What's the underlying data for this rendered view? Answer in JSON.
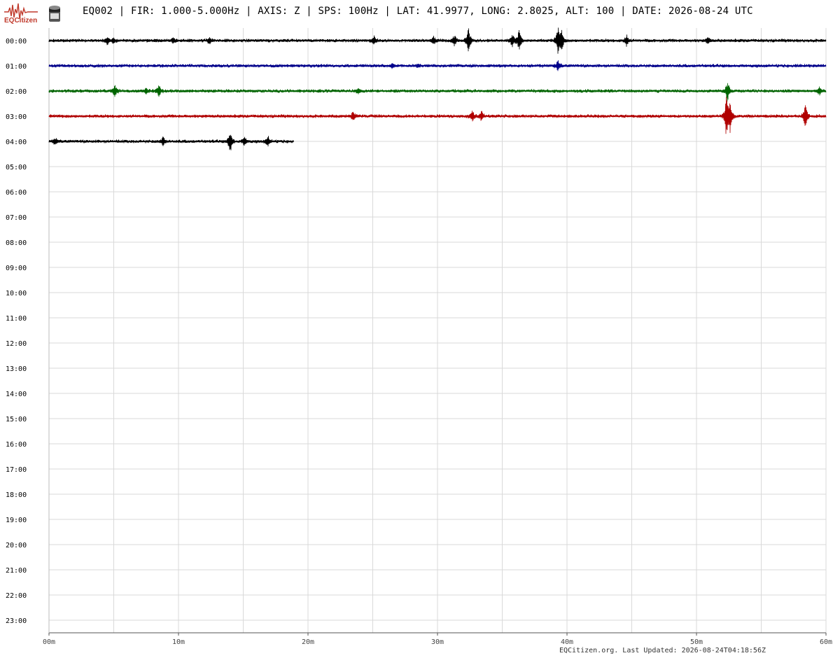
{
  "header": {
    "logo_text": "EQCitizen",
    "title": "EQ002 | FIR: 1.000-5.000Hz | AXIS: Z | SPS: 100Hz | LAT: 41.9977, LONG: 2.8025, ALT: 100 | DATE: 2026-08-24 UTC"
  },
  "footer": {
    "text": "EQCitizen.org. Last Updated: 2026-08-24T04:18:56Z"
  },
  "colors": {
    "grid": "#d9d9d9",
    "axis": "#555555",
    "logo": "#c0392b",
    "trace_cycle": [
      "#000000",
      "#00008b",
      "#006400",
      "#b00000"
    ]
  },
  "chart_data": {
    "type": "line",
    "title": "",
    "xlabel": "",
    "ylabel": "",
    "x_unit": "minutes",
    "xlim": [
      0,
      60
    ],
    "x_ticks": [
      0,
      10,
      20,
      30,
      40,
      50,
      60
    ],
    "x_tick_labels": [
      "00m",
      "10m",
      "20m",
      "30m",
      "40m",
      "50m",
      "60m"
    ],
    "x_minor_step": 5,
    "grid": true,
    "row_labels": [
      "00:00",
      "01:00",
      "02:00",
      "03:00",
      "04:00",
      "05:00",
      "06:00",
      "07:00",
      "08:00",
      "09:00",
      "10:00",
      "11:00",
      "12:00",
      "13:00",
      "14:00",
      "15:00",
      "16:00",
      "17:00",
      "18:00",
      "19:00",
      "20:00",
      "21:00",
      "22:00",
      "23:00"
    ],
    "series": [
      {
        "row": "00:00",
        "color": "#000000",
        "start_min": 0,
        "end_min": 60,
        "events": [
          [
            4.5,
            0.45
          ],
          [
            5.0,
            0.35
          ],
          [
            9.6,
            0.3
          ],
          [
            12.4,
            0.35
          ],
          [
            25.1,
            0.5
          ],
          [
            29.7,
            0.4
          ],
          [
            31.3,
            0.55
          ],
          [
            32.4,
            1.6
          ],
          [
            35.8,
            0.7
          ],
          [
            36.3,
            1.2
          ],
          [
            39.3,
            1.5
          ],
          [
            39.6,
            1.1
          ],
          [
            44.6,
            0.6
          ],
          [
            50.9,
            0.35
          ]
        ]
      },
      {
        "row": "01:00",
        "color": "#00008b",
        "start_min": 0,
        "end_min": 60,
        "events": [
          [
            26.5,
            0.25
          ],
          [
            28.5,
            0.2
          ],
          [
            39.3,
            0.6
          ]
        ]
      },
      {
        "row": "02:00",
        "color": "#006400",
        "start_min": 0,
        "end_min": 60,
        "events": [
          [
            5.1,
            0.7
          ],
          [
            7.5,
            0.35
          ],
          [
            8.5,
            0.8
          ],
          [
            23.9,
            0.3
          ],
          [
            52.4,
            1.2
          ],
          [
            59.5,
            0.4
          ]
        ]
      },
      {
        "row": "03:00",
        "color": "#b00000",
        "start_min": 0,
        "end_min": 60,
        "events": [
          [
            23.5,
            0.55
          ],
          [
            32.7,
            0.6
          ],
          [
            33.4,
            0.5
          ],
          [
            52.3,
            2.2
          ],
          [
            52.6,
            1.6
          ],
          [
            58.4,
            1.4
          ]
        ]
      },
      {
        "row": "04:00",
        "color": "#000000",
        "start_min": 0,
        "end_min": 18.9,
        "events": [
          [
            0.5,
            0.4
          ],
          [
            8.8,
            0.5
          ],
          [
            14.0,
            1.3
          ],
          [
            15.1,
            0.5
          ],
          [
            16.9,
            0.6
          ]
        ]
      }
    ]
  }
}
